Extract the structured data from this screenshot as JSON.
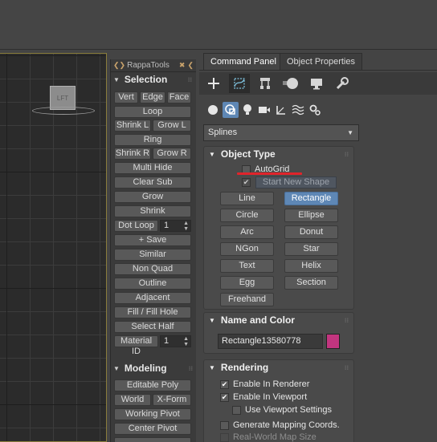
{
  "viewport": {
    "cube_label": "LFT"
  },
  "rappa": {
    "title": "RappaTools",
    "selection": {
      "header": "Selection",
      "vert": "Vert",
      "edge": "Edge",
      "face": "Face",
      "loop": "Loop",
      "shrink_l": "Shrink L",
      "grow_l": "Grow L",
      "ring": "Ring",
      "shrink_r": "Shrink R",
      "grow_r": "Grow R",
      "multi_hide": "Multi Hide",
      "clear_sub": "Clear Sub",
      "grow": "Grow",
      "shrink": "Shrink",
      "dot_loop": "Dot Loop",
      "dot_loop_value": "1",
      "save": "+ Save",
      "similar": "Similar",
      "non_quad": "Non Quad",
      "outline": "Outline",
      "adjacent": "Adjacent",
      "fill_hole": "Fill / Fill Hole",
      "select_half": "Select Half",
      "material_id": "Material ID",
      "material_id_value": "1"
    },
    "modeling": {
      "header": "Modeling",
      "editable_poly": "Editable Poly",
      "world": "World",
      "xform": "X-Form",
      "working_pivot": "Working Pivot",
      "center_pivot": "Center Pivot"
    }
  },
  "command_panel": {
    "tabs": [
      "Command Panel",
      "Object Properties"
    ],
    "active_tab": "Command Panel",
    "top_icons": [
      "create-icon",
      "modify-icon",
      "hierarchy-icon",
      "motion-icon",
      "display-icon",
      "utilities-icon"
    ],
    "create_icons": [
      "geometry-icon",
      "shapes-icon",
      "lights-icon",
      "cameras-icon",
      "helpers-icon",
      "spacewarps-icon",
      "systems-icon"
    ],
    "dropdown": {
      "value": "Splines"
    },
    "object_type": {
      "header": "Object Type",
      "autogrid": "AutoGrid",
      "start_new_shape": "Start New Shape",
      "buttons": [
        "Line",
        "Rectangle",
        "Circle",
        "Ellipse",
        "Arc",
        "Donut",
        "NGon",
        "Star",
        "Text",
        "Helix",
        "Egg",
        "Section",
        "Freehand"
      ],
      "active": "Rectangle"
    },
    "name_color": {
      "header": "Name and Color",
      "name": "Rectangle13580778",
      "color": "#c2357f"
    },
    "rendering": {
      "header": "Rendering",
      "enable_renderer": "Enable In Renderer",
      "enable_viewport": "Enable In Viewport",
      "use_viewport_settings": "Use Viewport Settings",
      "gen_mapping": "Generate Mapping Coords.",
      "real_world": "Real-World Map Size"
    }
  },
  "colors": {
    "accent": "#5e87b5",
    "annotation": "#e0242b"
  }
}
